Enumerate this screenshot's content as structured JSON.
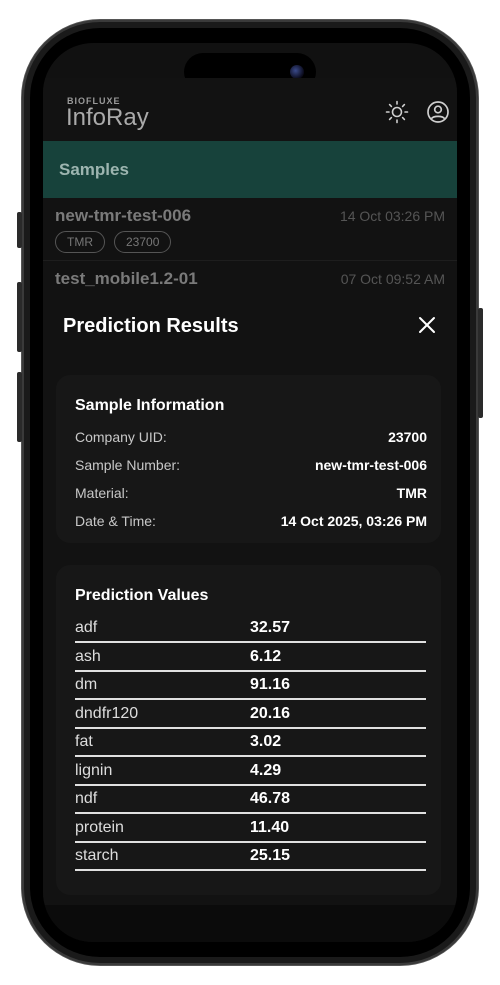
{
  "app": {
    "brand_small": "BIOFLUXE",
    "brand_name": "InfoRay"
  },
  "samples_header": "Samples",
  "samples": [
    {
      "name": "new-tmr-test-006",
      "time": "14 Oct 03:26 PM",
      "tags": [
        "TMR",
        "23700"
      ]
    },
    {
      "name": "test_mobile1.2-01",
      "time": "07 Oct 09:52 AM",
      "tags": []
    }
  ],
  "modal": {
    "title": "Prediction Results",
    "sample_info": {
      "title": "Sample Information",
      "rows": [
        {
          "label": "Company UID:",
          "value": "23700"
        },
        {
          "label": "Sample Number:",
          "value": "new-tmr-test-006"
        },
        {
          "label": "Material:",
          "value": "TMR"
        },
        {
          "label": "Date & Time:",
          "value": "14 Oct 2025, 03:26 PM"
        }
      ]
    },
    "prediction_values": {
      "title": "Prediction Values",
      "rows": [
        {
          "name": "adf",
          "value": "32.57"
        },
        {
          "name": "ash",
          "value": "6.12"
        },
        {
          "name": "dm",
          "value": "91.16"
        },
        {
          "name": "dndfr120",
          "value": "20.16"
        },
        {
          "name": "fat",
          "value": "3.02"
        },
        {
          "name": "lignin",
          "value": "4.29"
        },
        {
          "name": "ndf",
          "value": "46.78"
        },
        {
          "name": "protein",
          "value": "11.40"
        },
        {
          "name": "starch",
          "value": "25.15"
        }
      ]
    }
  },
  "icons": {
    "theme_toggle": "sun-icon",
    "profile": "user-circle-icon",
    "close": "close-icon"
  },
  "colors": {
    "accent": "#17423b",
    "background": "#121212",
    "card": "#171717"
  }
}
